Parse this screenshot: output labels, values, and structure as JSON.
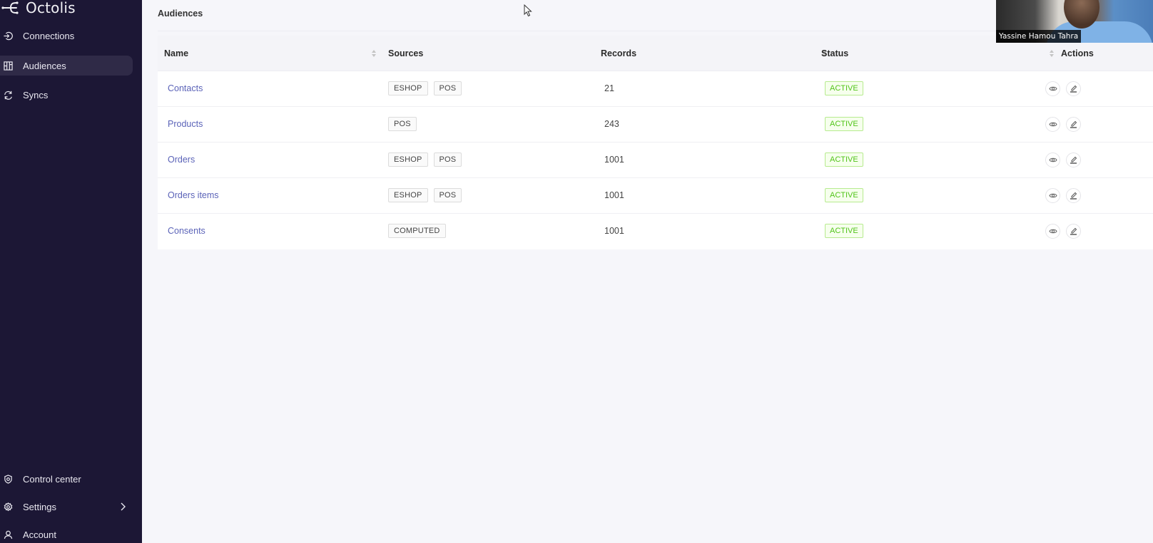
{
  "app": {
    "name": "Octolis"
  },
  "sidebar": {
    "top_items": [
      {
        "label": "Connections",
        "icon": "connections-icon",
        "active": false
      },
      {
        "label": "Audiences",
        "icon": "audiences-icon",
        "active": true
      },
      {
        "label": "Syncs",
        "icon": "syncs-icon",
        "active": false
      }
    ],
    "bottom_items": [
      {
        "label": "Control center",
        "icon": "shield-icon"
      },
      {
        "label": "Settings",
        "icon": "gear-icon",
        "has_submenu": true
      },
      {
        "label": "Account",
        "icon": "user-icon"
      }
    ]
  },
  "page": {
    "title": "Audiences"
  },
  "table": {
    "columns": [
      "Name",
      "Sources",
      "Records",
      "Status",
      "Actions"
    ],
    "rows": [
      {
        "name": "Contacts",
        "sources": [
          "ESHOP",
          "POS"
        ],
        "records": "21",
        "status": "ACTIVE"
      },
      {
        "name": "Products",
        "sources": [
          "POS"
        ],
        "records": "243",
        "status": "ACTIVE"
      },
      {
        "name": "Orders",
        "sources": [
          "ESHOP",
          "POS"
        ],
        "records": "1001",
        "status": "ACTIVE"
      },
      {
        "name": "Orders items",
        "sources": [
          "ESHOP",
          "POS"
        ],
        "records": "1001",
        "status": "ACTIVE"
      },
      {
        "name": "Consents",
        "sources": [
          "COMPUTED"
        ],
        "records": "1001",
        "status": "ACTIVE"
      }
    ]
  },
  "video_overlay": {
    "participant_name": "Yassine Hamou Tahra"
  },
  "colors": {
    "sidebar_bg": "#1c1735",
    "link": "#5b63b8",
    "status_active": "#52c41a"
  }
}
